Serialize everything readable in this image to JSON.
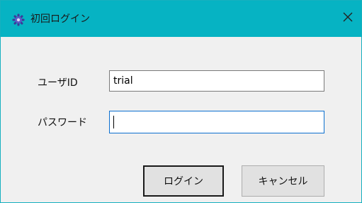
{
  "window": {
    "title": "初回ログイン",
    "title_icon": "gear-icon",
    "close_icon": "close-icon"
  },
  "form": {
    "user_id_label": "ユーザID",
    "user_id_value": "trial",
    "password_label": "パスワード",
    "password_value": ""
  },
  "buttons": {
    "login_label": "ログイン",
    "cancel_label": "キャンセル"
  },
  "colors": {
    "titlebar": "#06b3c3",
    "focus_border": "#0b6fcf",
    "dialog_background": "#f0f0f0"
  }
}
